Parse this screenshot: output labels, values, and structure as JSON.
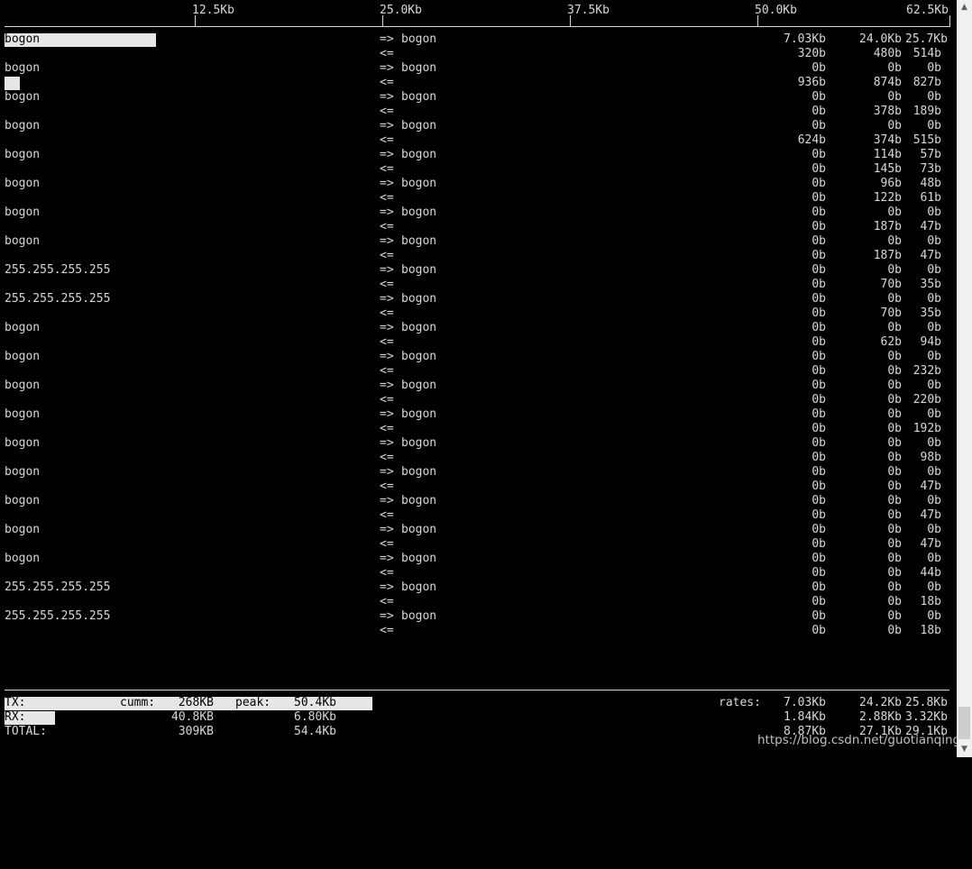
{
  "scale": {
    "labels": [
      "12.5Kb",
      "25.0Kb",
      "37.5Kb",
      "50.0Kb",
      "62.5Kb"
    ]
  },
  "connections": [
    {
      "host": "bogon",
      "peer": "bogon",
      "out_dir": "=>",
      "in_dir": "<=",
      "out": [
        "7.03Kb",
        "24.0Kb",
        "25.7Kb"
      ],
      "in": [
        "320b",
        "480b",
        "514b"
      ],
      "host_bar_level": 0.411
    },
    {
      "host": "bogon",
      "peer": "bogon",
      "out_dir": "=>",
      "in_dir": "<=",
      "out": [
        "0b",
        "0b",
        "0b"
      ],
      "in": [
        "936b",
        "874b",
        "827b"
      ],
      "in_bar_level": 0.017
    },
    {
      "host": "bogon",
      "peer": "bogon",
      "out_dir": "=>",
      "in_dir": "<=",
      "out": [
        "0b",
        "0b",
        "0b"
      ],
      "in": [
        "0b",
        "378b",
        "189b"
      ]
    },
    {
      "host": "bogon",
      "peer": "bogon",
      "out_dir": "=>",
      "in_dir": "<=",
      "out": [
        "0b",
        "0b",
        "0b"
      ],
      "in": [
        "624b",
        "374b",
        "515b"
      ]
    },
    {
      "host": "bogon",
      "peer": "bogon",
      "out_dir": "=>",
      "in_dir": "<=",
      "out": [
        "0b",
        "114b",
        "57b"
      ],
      "in": [
        "0b",
        "145b",
        "73b"
      ]
    },
    {
      "host": "bogon",
      "peer": "bogon",
      "out_dir": "=>",
      "in_dir": "<=",
      "out": [
        "0b",
        "96b",
        "48b"
      ],
      "in": [
        "0b",
        "122b",
        "61b"
      ]
    },
    {
      "host": "bogon",
      "peer": "bogon",
      "out_dir": "=>",
      "in_dir": "<=",
      "out": [
        "0b",
        "0b",
        "0b"
      ],
      "in": [
        "0b",
        "187b",
        "47b"
      ]
    },
    {
      "host": "bogon",
      "peer": "bogon",
      "out_dir": "=>",
      "in_dir": "<=",
      "out": [
        "0b",
        "0b",
        "0b"
      ],
      "in": [
        "0b",
        "187b",
        "47b"
      ]
    },
    {
      "host": "255.255.255.255",
      "peer": "bogon",
      "out_dir": "=>",
      "in_dir": "<=",
      "out": [
        "0b",
        "0b",
        "0b"
      ],
      "in": [
        "0b",
        "70b",
        "35b"
      ]
    },
    {
      "host": "255.255.255.255",
      "peer": "bogon",
      "out_dir": "=>",
      "in_dir": "<=",
      "out": [
        "0b",
        "0b",
        "0b"
      ],
      "in": [
        "0b",
        "70b",
        "35b"
      ]
    },
    {
      "host": "bogon",
      "peer": "bogon",
      "out_dir": "=>",
      "in_dir": "<=",
      "out": [
        "0b",
        "0b",
        "0b"
      ],
      "in": [
        "0b",
        "62b",
        "94b"
      ]
    },
    {
      "host": "bogon",
      "peer": "bogon",
      "out_dir": "=>",
      "in_dir": "<=",
      "out": [
        "0b",
        "0b",
        "0b"
      ],
      "in": [
        "0b",
        "0b",
        "232b"
      ]
    },
    {
      "host": "bogon",
      "peer": "bogon",
      "out_dir": "=>",
      "in_dir": "<=",
      "out": [
        "0b",
        "0b",
        "0b"
      ],
      "in": [
        "0b",
        "0b",
        "220b"
      ]
    },
    {
      "host": "bogon",
      "peer": "bogon",
      "out_dir": "=>",
      "in_dir": "<=",
      "out": [
        "0b",
        "0b",
        "0b"
      ],
      "in": [
        "0b",
        "0b",
        "192b"
      ]
    },
    {
      "host": "bogon",
      "peer": "bogon",
      "out_dir": "=>",
      "in_dir": "<=",
      "out": [
        "0b",
        "0b",
        "0b"
      ],
      "in": [
        "0b",
        "0b",
        "98b"
      ]
    },
    {
      "host": "bogon",
      "peer": "bogon",
      "out_dir": "=>",
      "in_dir": "<=",
      "out": [
        "0b",
        "0b",
        "0b"
      ],
      "in": [
        "0b",
        "0b",
        "47b"
      ]
    },
    {
      "host": "bogon",
      "peer": "bogon",
      "out_dir": "=>",
      "in_dir": "<=",
      "out": [
        "0b",
        "0b",
        "0b"
      ],
      "in": [
        "0b",
        "0b",
        "47b"
      ]
    },
    {
      "host": "bogon",
      "peer": "bogon",
      "out_dir": "=>",
      "in_dir": "<=",
      "out": [
        "0b",
        "0b",
        "0b"
      ],
      "in": [
        "0b",
        "0b",
        "47b"
      ]
    },
    {
      "host": "bogon",
      "peer": "bogon",
      "out_dir": "=>",
      "in_dir": "<=",
      "out": [
        "0b",
        "0b",
        "0b"
      ],
      "in": [
        "0b",
        "0b",
        "44b"
      ]
    },
    {
      "host": "255.255.255.255",
      "peer": "bogon",
      "out_dir": "=>",
      "in_dir": "<=",
      "out": [
        "0b",
        "0b",
        "0b"
      ],
      "in": [
        "0b",
        "0b",
        "18b"
      ]
    },
    {
      "host": "255.255.255.255",
      "peer": "bogon",
      "out_dir": "=>",
      "in_dir": "<=",
      "out": [
        "0b",
        "0b",
        "0b"
      ],
      "in": [
        "0b",
        "0b",
        "18b"
      ]
    }
  ],
  "summary": {
    "tx": {
      "label": "TX:",
      "cumm_label": "cumm:",
      "cumm": "268KB",
      "peak_label": "peak:",
      "peak": "50.4Kb",
      "rates_label": "rates:",
      "rates": [
        "7.03Kb",
        "24.2Kb",
        "25.8Kb"
      ],
      "bar_level": 1.0
    },
    "rx": {
      "label": "RX:",
      "cumm": "40.8KB",
      "peak": "6.80Kb",
      "rates": [
        "1.84Kb",
        "2.88Kb",
        "3.32Kb"
      ],
      "bar_level": 0.137
    },
    "total": {
      "label": "TOTAL:",
      "cumm": "309KB",
      "peak": "54.4Kb",
      "rates": [
        "8.87Kb",
        "27.1Kb",
        "29.1Kb"
      ]
    }
  },
  "watermark": "https://blog.csdn.net/guotianqing",
  "colors": {
    "background": "#000000",
    "text": "#d8d8d8",
    "bar": "#e6e6e6"
  }
}
